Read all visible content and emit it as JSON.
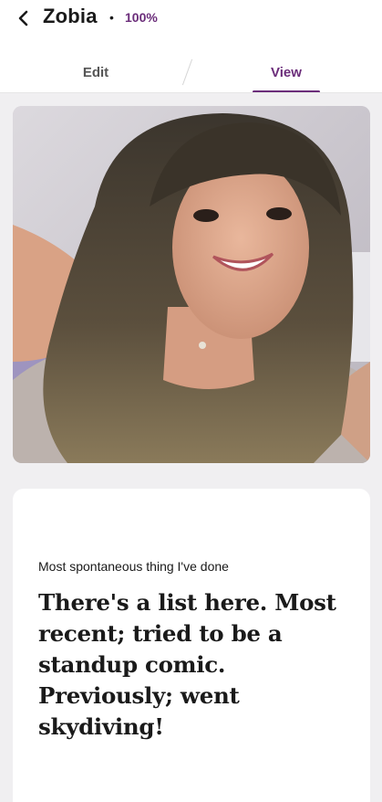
{
  "header": {
    "back_icon": "chevron-left-icon",
    "name": "Zobia",
    "separator": "•",
    "completion": "100%"
  },
  "tabs": [
    {
      "label": "Edit",
      "active": false
    },
    {
      "label": "View",
      "active": true
    }
  ],
  "colors": {
    "accent": "#6b2d7a",
    "background": "#f0eff1",
    "card": "#ffffff",
    "text": "#1a1a1a"
  },
  "photo": {
    "subject": "selfie of smiling woman with long dark hair and bangs, grey t-shirt"
  },
  "prompt_card": {
    "prompt": "Most spontaneous thing I've done",
    "answer": "There's a list here. Most recent; tried to be a standup comic. Previously; went skydiving!"
  }
}
